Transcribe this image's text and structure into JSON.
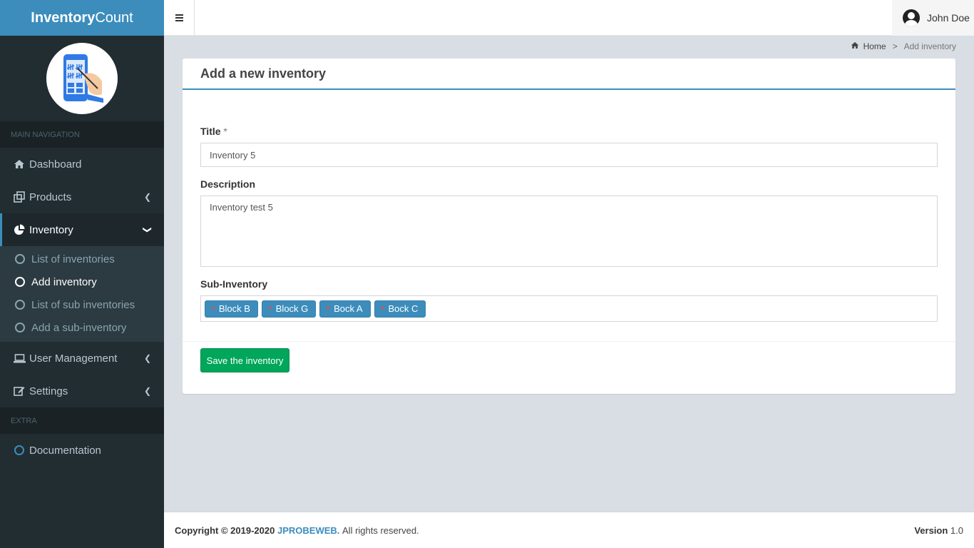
{
  "app": {
    "name_bold": "Inventory",
    "name_light": "Count"
  },
  "header": {
    "user_name": "John Doe"
  },
  "sidebar": {
    "section_main": "MAIN NAVIGATION",
    "items": [
      {
        "label": "Dashboard",
        "icon": "home-icon"
      },
      {
        "label": "Products",
        "icon": "clone-icon"
      },
      {
        "label": "Inventory",
        "icon": "pie-chart-icon"
      },
      {
        "label": "User Management",
        "icon": "laptop-icon"
      },
      {
        "label": "Settings",
        "icon": "edit-icon"
      }
    ],
    "inventory_sub": [
      {
        "label": "List of inventories"
      },
      {
        "label": "Add inventory"
      },
      {
        "label": "List of sub inventories"
      },
      {
        "label": "Add a sub-inventory"
      }
    ],
    "section_extra": "EXTRA",
    "documentation": "Documentation"
  },
  "breadcrumb": {
    "home": "Home",
    "sep": ">",
    "current": "Add inventory"
  },
  "form": {
    "title": "Add a new inventory",
    "title_label": "Title",
    "title_required": "*",
    "title_value": "Inventory 5",
    "description_label": "Description",
    "description_value": "Inventory test 5",
    "sub_label": "Sub-Inventory",
    "tags": [
      "Block B",
      "Block G",
      "Bock A",
      "Bock C"
    ],
    "tag_remove": "×",
    "save_label": "Save the inventory"
  },
  "footer": {
    "copyright_prefix": "Copyright © 2019-2020",
    "brand": "JPROBEWEB.",
    "rights": "All rights reserved.",
    "version_label": "Version",
    "version_value": "1.0"
  },
  "colors": {
    "primary": "#3c8dbc",
    "success": "#00a65a",
    "sidebar": "#222d32"
  }
}
